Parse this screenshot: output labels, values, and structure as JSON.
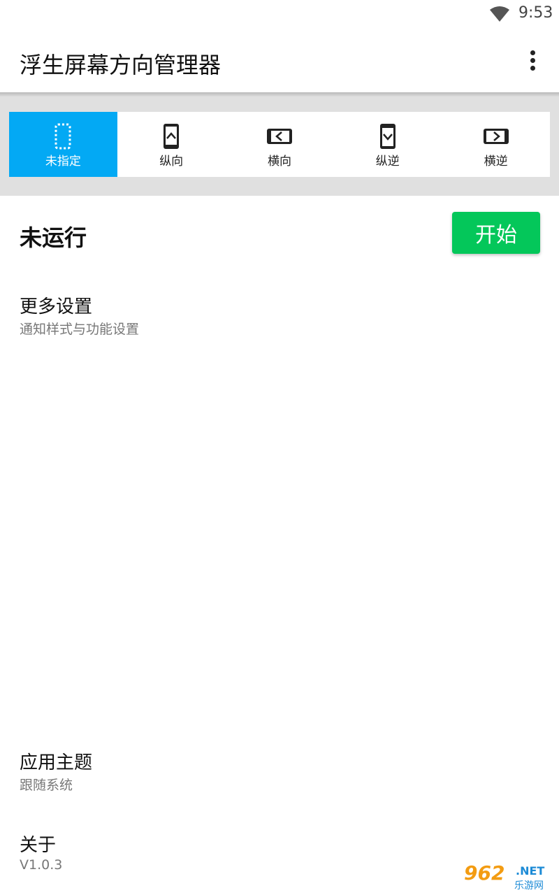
{
  "status_bar": {
    "time": "9:53",
    "wifi_icon": "wifi-icon"
  },
  "app_bar": {
    "title": "浮生屏幕方向管理器",
    "menu_icon": "more-vert-icon"
  },
  "orientation": {
    "selected_index": 0,
    "accent_color": "#03a9f4",
    "items": [
      {
        "label": "未指定",
        "icon": "unspecified-orientation-icon"
      },
      {
        "label": "纵向",
        "icon": "portrait-icon"
      },
      {
        "label": "横向",
        "icon": "landscape-icon"
      },
      {
        "label": "纵逆",
        "icon": "reverse-portrait-icon"
      },
      {
        "label": "横逆",
        "icon": "reverse-landscape-icon"
      }
    ]
  },
  "service": {
    "status": "未运行",
    "start_label": "开始",
    "start_color": "#04c75a"
  },
  "settings": [
    {
      "title": "更多设置",
      "subtitle": "通知样式与功能设置"
    },
    {
      "title": "应用主题",
      "subtitle": "跟随系统"
    },
    {
      "title": "关于",
      "subtitle": "V1.0.3"
    }
  ],
  "watermark": {
    "number": "962",
    "suffix": ".NET",
    "site": "乐游网"
  }
}
